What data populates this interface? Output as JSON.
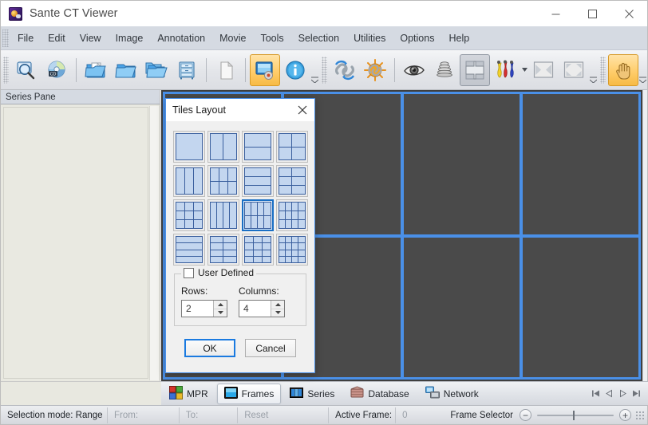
{
  "window": {
    "title": "Sante CT Viewer",
    "app_icon": "app-logo-icon",
    "minimize_label": "Minimize",
    "maximize_label": "Maximize",
    "close_label": "Close"
  },
  "menubar": {
    "items": [
      {
        "label": "File"
      },
      {
        "label": "Edit"
      },
      {
        "label": "View"
      },
      {
        "label": "Image"
      },
      {
        "label": "Annotation"
      },
      {
        "label": "Movie"
      },
      {
        "label": "Tools"
      },
      {
        "label": "Selection"
      },
      {
        "label": "Utilities"
      },
      {
        "label": "Options"
      },
      {
        "label": "Help"
      }
    ]
  },
  "toolbar": {
    "group1": [
      {
        "name": "search-images-icon",
        "tip": "Search"
      },
      {
        "name": "open-cd-icon",
        "tip": "Open CD/DVD"
      }
    ],
    "group2": [
      {
        "name": "open-file-icon",
        "tip": "Open File"
      },
      {
        "name": "open-folder-icon",
        "tip": "Open Folder"
      },
      {
        "name": "open-folders-icon",
        "tip": "Open Multiple Folders"
      },
      {
        "name": "database-icon",
        "tip": "Database"
      }
    ],
    "group3": [
      {
        "name": "copy-page-icon",
        "tip": "Copy"
      }
    ],
    "group4": [
      {
        "name": "tiles-layout-icon",
        "tip": "Tiles Layout",
        "state": "active"
      },
      {
        "name": "info-icon",
        "tip": "Information"
      }
    ],
    "group5": [
      {
        "name": "link-sync-icon",
        "tip": "Link Series"
      },
      {
        "name": "link-unsync-icon",
        "tip": "Unlink Series"
      }
    ],
    "group6": [
      {
        "name": "eye-icon",
        "tip": "Show/Hide"
      },
      {
        "name": "stack-icon",
        "tip": "Stack"
      },
      {
        "name": "crosshair-icon",
        "tip": "Crosshair",
        "state": "pressed"
      },
      {
        "name": "color-palette-icon",
        "tip": "Color Palette"
      },
      {
        "name": "fit-width-icon",
        "tip": "Fit Width"
      },
      {
        "name": "fit-screen-icon",
        "tip": "Fit To Screen"
      }
    ],
    "group7": [
      {
        "name": "pan-hand-icon",
        "tip": "Pan",
        "state": "active"
      }
    ]
  },
  "series_pane": {
    "header": "Series Pane"
  },
  "viewport": {
    "rows": 2,
    "columns": 4,
    "tile_border_color": "#4a90e8",
    "tile_background": "#4a4a4a",
    "tiles": [
      {
        "index": 0
      },
      {
        "index": 1
      },
      {
        "index": 2
      },
      {
        "index": 3
      },
      {
        "index": 4
      },
      {
        "index": 5
      },
      {
        "index": 6
      },
      {
        "index": 7
      }
    ]
  },
  "dialog": {
    "title": "Tiles Layout",
    "close_icon": "close-icon",
    "selected_index": 10,
    "layouts": [
      {
        "rows": 1,
        "cols": 1
      },
      {
        "rows": 1,
        "cols": 2
      },
      {
        "rows": 2,
        "cols": 1
      },
      {
        "rows": 2,
        "cols": 2
      },
      {
        "rows": 1,
        "cols": 3
      },
      {
        "rows": 2,
        "cols": 3
      },
      {
        "rows": 3,
        "cols": 1
      },
      {
        "rows": 3,
        "cols": 2
      },
      {
        "rows": 3,
        "cols": 3
      },
      {
        "rows": 1,
        "cols": 4
      },
      {
        "rows": 2,
        "cols": 4
      },
      {
        "rows": 3,
        "cols": 4
      },
      {
        "rows": 4,
        "cols": 1
      },
      {
        "rows": 4,
        "cols": 2
      },
      {
        "rows": 4,
        "cols": 3
      },
      {
        "rows": 4,
        "cols": 4
      }
    ],
    "user_defined": {
      "label": "User Defined",
      "checked": false,
      "rows_label": "Rows:",
      "rows_value": "2",
      "columns_label": "Columns:",
      "columns_value": "4"
    },
    "ok_label": "OK",
    "cancel_label": "Cancel"
  },
  "tabbar": {
    "tabs": [
      {
        "label": "MPR",
        "icon": "mpr-icon",
        "selected": false
      },
      {
        "label": "Frames",
        "icon": "frames-icon",
        "selected": true
      },
      {
        "label": "Series",
        "icon": "series-icon",
        "selected": false
      },
      {
        "label": "Database",
        "icon": "database-icon",
        "selected": false
      },
      {
        "label": "Network",
        "icon": "network-icon",
        "selected": false
      }
    ],
    "nav": [
      {
        "name": "first-frame-button"
      },
      {
        "name": "previous-frame-button"
      },
      {
        "name": "next-frame-button"
      },
      {
        "name": "last-frame-button"
      }
    ]
  },
  "statusbar": {
    "selection_mode": "Selection mode: Range",
    "from_label": "From:",
    "to_label": "To:",
    "reset_label": "Reset",
    "active_frame_label": "Active Frame:",
    "active_frame_value": "0",
    "frame_selector_label": "Frame Selector",
    "minus_label": "−",
    "plus_label": "+"
  },
  "colors": {
    "accent_blue": "#4a90e8",
    "selection_blue": "#1a6fc4",
    "toolbar_active": "#ffcd6b",
    "menu_bg": "#d5dae2",
    "pane_bg": "#e6e6de",
    "viewport_bg": "#4a4a4a"
  }
}
